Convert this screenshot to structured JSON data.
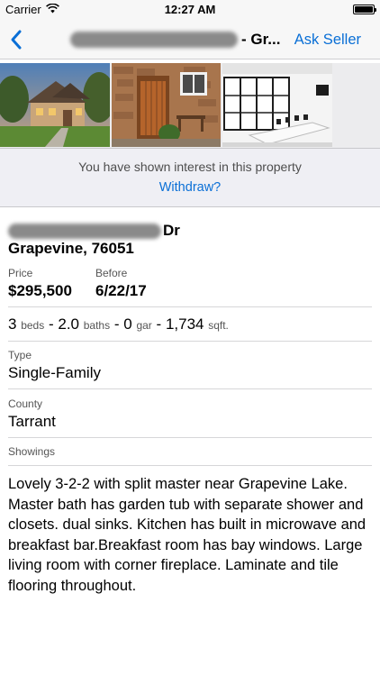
{
  "status_bar": {
    "carrier": "Carrier",
    "time": "12:27 AM"
  },
  "nav": {
    "title_suffix": "- Gr...",
    "ask_seller": "Ask Seller"
  },
  "photos": [
    {
      "name": "house-exterior-photo"
    },
    {
      "name": "wooden-door-photo"
    },
    {
      "name": "office-interior-photo"
    }
  ],
  "interest": {
    "message": "You have shown interest in this property",
    "withdraw": "Withdraw?"
  },
  "listing": {
    "street_suffix": "Dr",
    "city_zip": "Grapevine, 76051",
    "price_label": "Price",
    "price": "$295,500",
    "before_label": "Before",
    "before_date": "6/22/17",
    "beds": "3",
    "beds_unit": "beds",
    "baths": "2.0",
    "baths_unit": "baths",
    "garage": "0",
    "garage_unit": "gar",
    "sqft": "1,734",
    "sqft_unit": "sqft.",
    "spec_separator": "-",
    "type_label": "Type",
    "type": "Single-Family",
    "county_label": "County",
    "county": "Tarrant",
    "showings_label": "Showings",
    "description": "Lovely 3-2-2 with split master near Grapevine Lake. Master bath has garden tub with separate shower and closets. dual sinks. Kitchen has built in microwave and breakfast bar.Breakfast room has bay windows. Large living room with corner fireplace. Laminate and tile flooring throughout."
  },
  "colors": {
    "accent": "#0a6fd6",
    "banner_bg": "#efeff4",
    "nav_bg": "#f7f7f7"
  },
  "icons": {
    "back": "chevron-left-icon",
    "wifi": "wifi-icon",
    "battery": "battery-icon"
  }
}
